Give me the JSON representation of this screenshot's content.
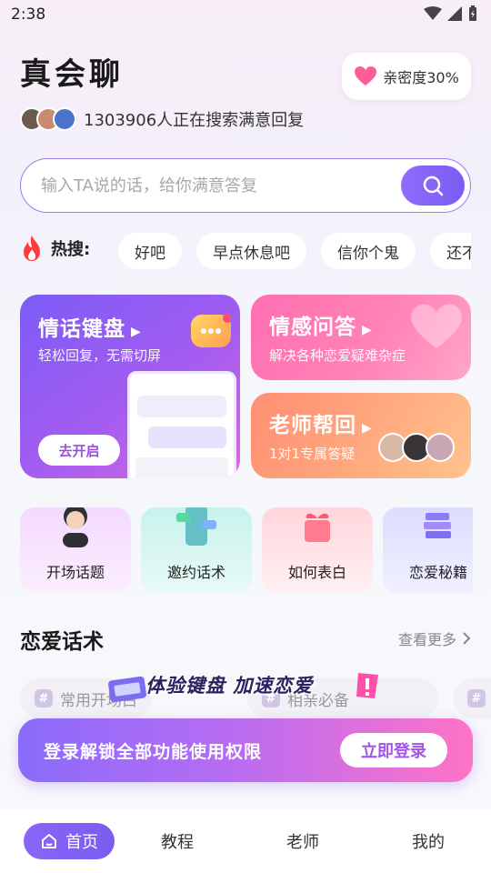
{
  "status_bar": {
    "time": "2:38"
  },
  "header": {
    "app_title": "真会聊",
    "intimacy_label": "亲密度30%",
    "searchers_text": "1303906人正在搜索满意回复"
  },
  "search": {
    "placeholder": "输入TA说的话，给你满意答复",
    "button_icon": "search-icon"
  },
  "hot_search": {
    "label": "热搜:",
    "chips": [
      "好吧",
      "早点休息吧",
      "信你个鬼",
      "还不"
    ]
  },
  "feature_cards": {
    "keyboard": {
      "title": "情话键盘",
      "subtitle": "轻松回复，无需切屏",
      "button": "去开启"
    },
    "emotion": {
      "title": "情感问答",
      "subtitle": "解决各种恋爱疑难杂症"
    },
    "teacher": {
      "title": "老师帮回",
      "subtitle": "1对1专属答疑"
    }
  },
  "tiles": [
    {
      "label": "开场话题",
      "icon": "boy-avatar-icon"
    },
    {
      "label": "邀约话术",
      "icon": "chat-phone-icon"
    },
    {
      "label": "如何表白",
      "icon": "gift-heart-icon"
    },
    {
      "label": "恋爱秘籍",
      "icon": "book-stack-icon"
    }
  ],
  "love_phrases": {
    "title": "恋爱话术",
    "see_more": "查看更多",
    "phrases": [
      "常用开场白",
      "相亲必备"
    ]
  },
  "promo": {
    "slogan": "体验键盘 加速恋爱",
    "text": "登录解锁全部功能使用权限",
    "button": "立即登录"
  },
  "nav": {
    "items": [
      "首页",
      "教程",
      "老师",
      "我的"
    ],
    "active": "首页"
  },
  "colors": {
    "accent": "#7b5cf2",
    "pink": "#ff6fb0",
    "orange": "#ff8e73"
  }
}
